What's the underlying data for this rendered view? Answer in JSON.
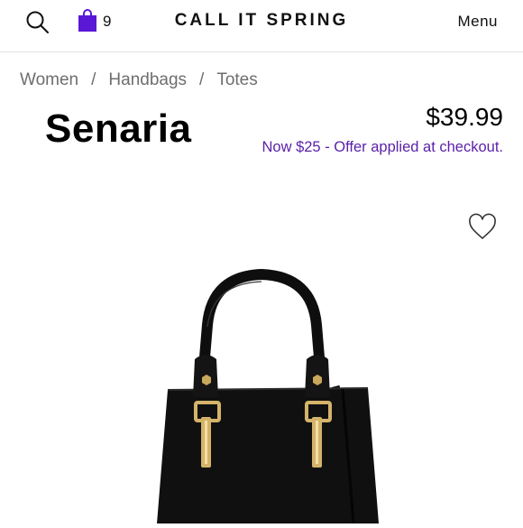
{
  "header": {
    "brand": "CALL IT SPRING",
    "cart_count": "9",
    "menu_label": "Menu",
    "search_icon": "search-icon",
    "bag_icon": "shopping-bag-icon",
    "bag_color": "#5a17d6"
  },
  "breadcrumb": {
    "items": [
      "Women",
      "Handbags",
      "Totes"
    ],
    "separator": "/"
  },
  "product": {
    "name": "Senaria",
    "price": "$39.99",
    "promo": "Now $25 - Offer applied at checkout.",
    "promo_color": "#5a1fa8",
    "wishlist_icon": "heart-icon",
    "image": "black-tote-handbag"
  }
}
